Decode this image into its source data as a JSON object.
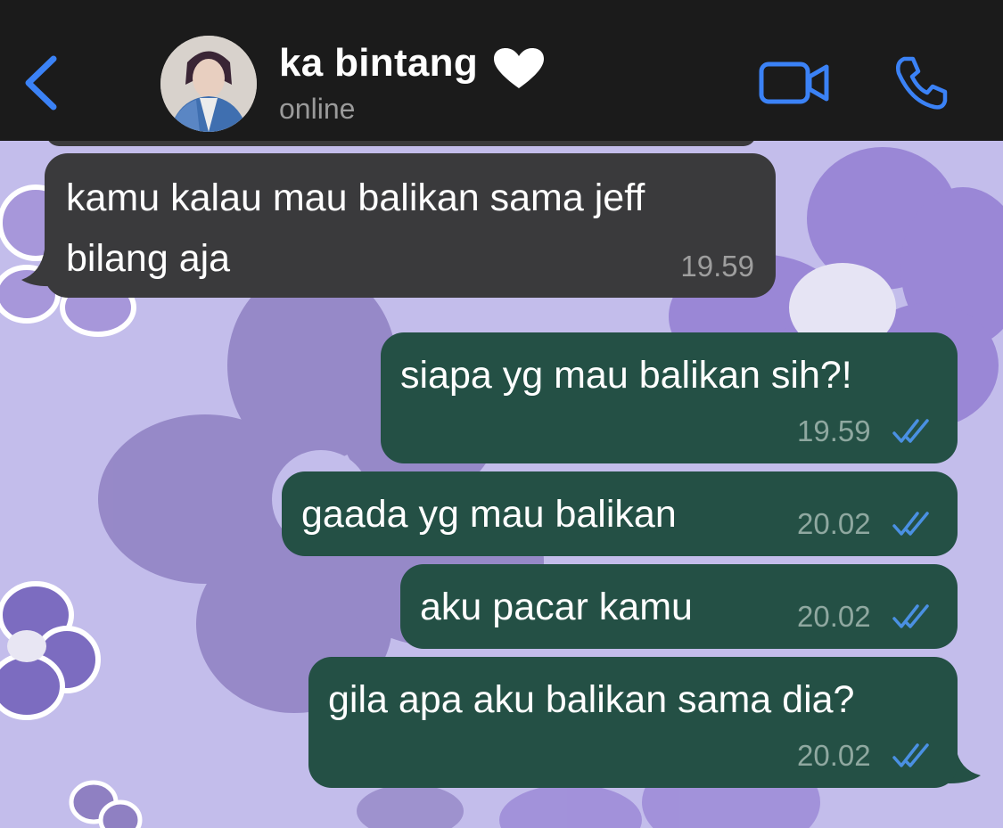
{
  "header": {
    "contact_name": "ka bintang",
    "status": "online",
    "heart_emoji": "white-heart-icon",
    "accent_color": "#3b82f6"
  },
  "messages": [
    {
      "direction": "incoming",
      "lines": [
        "kamu kalau mau balikan sama jeff",
        "bilang aja"
      ],
      "time": "19.59"
    },
    {
      "direction": "outgoing",
      "lines": [
        "siapa yg mau balikan sih?!"
      ],
      "time": "19.59",
      "read": true
    },
    {
      "direction": "outgoing",
      "lines": [
        "gaada yg mau balikan"
      ],
      "time": "20.02",
      "read": true
    },
    {
      "direction": "outgoing",
      "lines": [
        "aku pacar kamu"
      ],
      "time": "20.02",
      "read": true
    },
    {
      "direction": "outgoing",
      "lines": [
        "gila apa aku balikan sama dia?"
      ],
      "time": "20.02",
      "read": true
    }
  ],
  "colors": {
    "incoming_bubble": "#3a3a3c",
    "outgoing_bubble": "#245045",
    "read_tick": "#4a90e2",
    "wallpaper": "#c3bdeb"
  }
}
